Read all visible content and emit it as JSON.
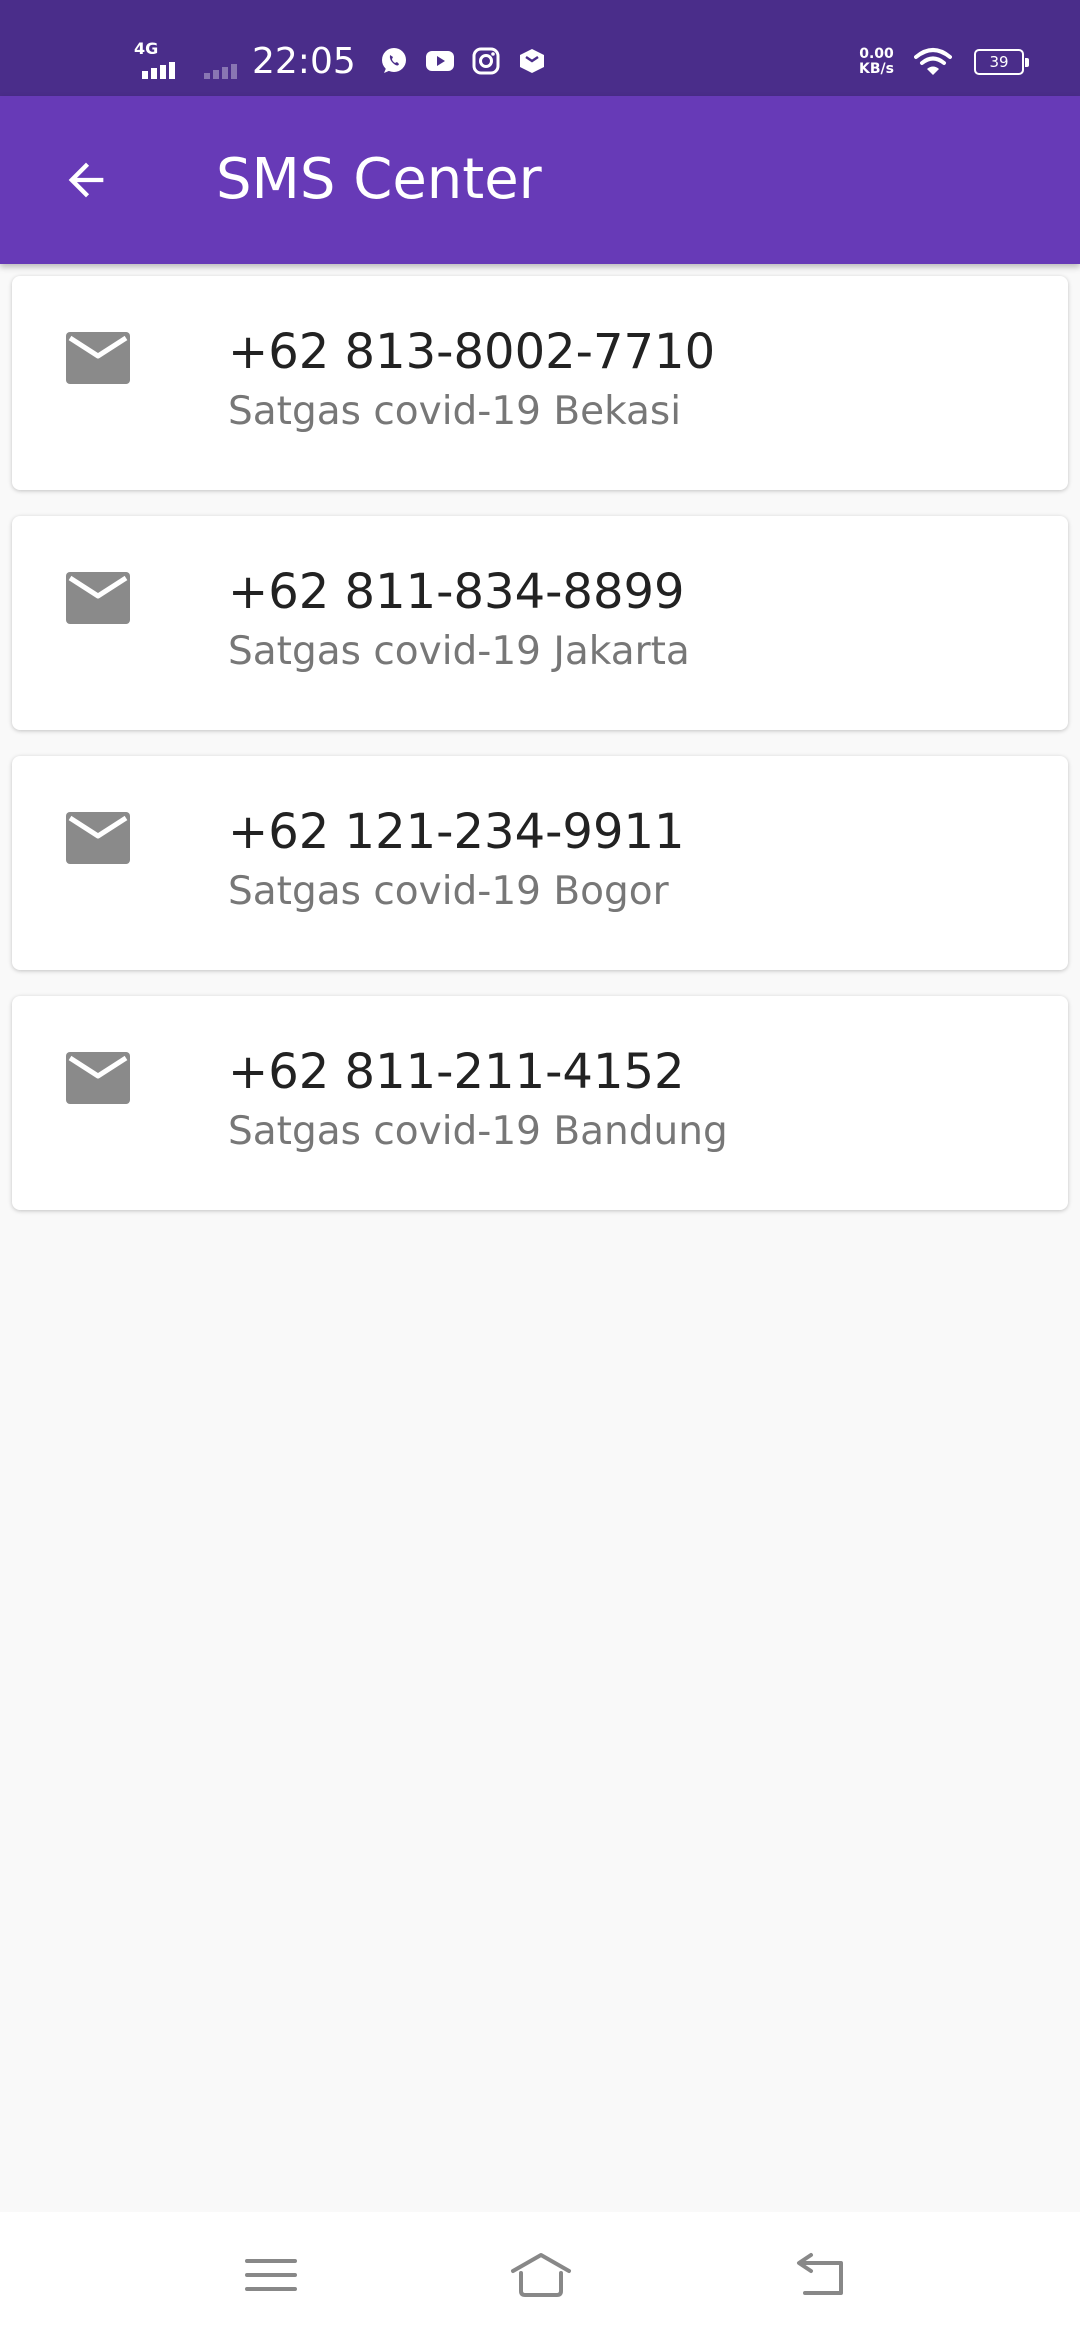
{
  "status_bar": {
    "network_label": "4G",
    "time": "22:05",
    "apps": [
      "whatsapp-icon",
      "youtube-icon",
      "instagram-icon",
      "lazada-icon"
    ],
    "net_speed_value": "0.00",
    "net_speed_unit": "KB/s",
    "battery": "39"
  },
  "app_bar": {
    "title": "SMS Center"
  },
  "contacts": [
    {
      "phone": "+62 813-8002-7710",
      "label": "Satgas covid-19 Bekasi"
    },
    {
      "phone": "+62 811-834-8899",
      "label": "Satgas covid-19 Jakarta"
    },
    {
      "phone": "+62 121-234-9911",
      "label": "Satgas covid-19 Bogor"
    },
    {
      "phone": "+62 811-211-4152",
      "label": "Satgas covid-19 Bandung"
    }
  ],
  "colors": {
    "status_bar": "#4a2d8a",
    "app_bar": "#673ab7",
    "background": "#f9f9f9",
    "icon_gray": "#8a8a8a"
  }
}
